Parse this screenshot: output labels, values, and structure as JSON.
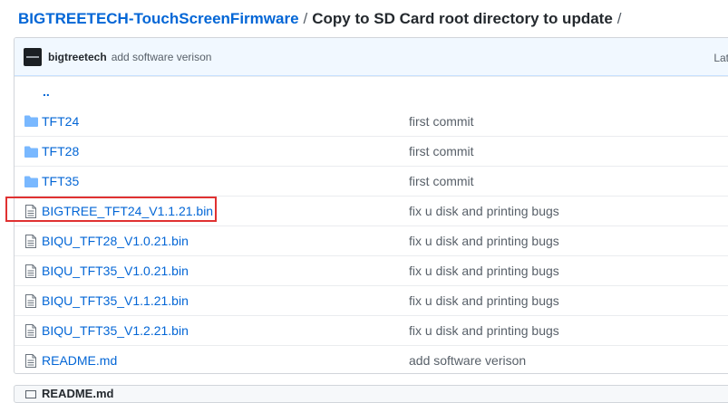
{
  "breadcrumb": {
    "repo": "BIGTREETECH-TouchScreenFirmware",
    "separator1": "/",
    "folder": "Copy to SD Card root directory to update",
    "separator2": "/"
  },
  "commit": {
    "author": "bigtreetech",
    "message": "add software verison",
    "latest_label": "Lat"
  },
  "up_link": "..",
  "files": [
    {
      "name": "TFT24",
      "type": "folder",
      "message": "first commit"
    },
    {
      "name": "TFT28",
      "type": "folder",
      "message": "first commit"
    },
    {
      "name": "TFT35",
      "type": "folder",
      "message": "first commit"
    },
    {
      "name": "BIGTREE_TFT24_V1.1.21.bin",
      "type": "file",
      "message": "fix u disk and printing bugs"
    },
    {
      "name": "BIQU_TFT28_V1.0.21.bin",
      "type": "file",
      "message": "fix u disk and printing bugs"
    },
    {
      "name": "BIQU_TFT35_V1.0.21.bin",
      "type": "file",
      "message": "fix u disk and printing bugs"
    },
    {
      "name": "BIQU_TFT35_V1.1.21.bin",
      "type": "file",
      "message": "fix u disk and printing bugs"
    },
    {
      "name": "BIQU_TFT35_V1.2.21.bin",
      "type": "file",
      "message": "fix u disk and printing bugs"
    },
    {
      "name": "README.md",
      "type": "file",
      "message": "add software verison"
    }
  ],
  "readme_label": "README.md",
  "colors": {
    "link": "#0366d6",
    "highlight": "#e03131",
    "folder": "#79b8ff"
  }
}
